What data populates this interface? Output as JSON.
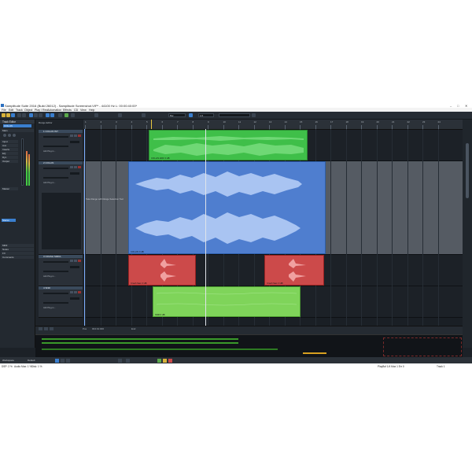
{
  "window": {
    "title": "Samplitude Suite 2016 (Build 26012) - Samplitude Screenshot.VIP* - 44100 Hz L: 00:00:40:00*",
    "min": "–",
    "max": "□",
    "close": "✕"
  },
  "menu": [
    "File",
    "Edit",
    "Track",
    "Object",
    "Play / Rec",
    "Automation",
    "Effects",
    "CD",
    "View",
    "Help"
  ],
  "toolbar": {
    "icons": [
      "new-icon",
      "open-icon",
      "save-icon",
      "undo-icon",
      "redo-icon",
      "cursor-icon",
      "range-icon",
      "cut-icon",
      "draw-icon",
      "zoom-icon",
      "mix-icon",
      "record-icon"
    ],
    "bpm_select": "Bar",
    "grid_select": "1/4",
    "search_placeholder": ""
  },
  "left_panel": {
    "header": "Track Editor",
    "section_main": "Main",
    "track_name": "COLLIN",
    "labels": [
      "Input",
      "Aux",
      "Inserts",
      "EQ",
      "Dyn",
      "Output"
    ],
    "routing": "Master",
    "preset_label": "Stereo",
    "sections": [
      "MIDI",
      "Notes",
      "FX",
      "Comments"
    ]
  },
  "tracks": [
    {
      "num": "1",
      "name": "COLLIN INT",
      "add_plugin": "Add Plug-in..."
    },
    {
      "num": "2",
      "name": "COLLIN",
      "add_plugin": "Add Plug-in..."
    },
    {
      "num": "3",
      "name": "CRASH SIMUL",
      "add_plugin": "Add Plug-in..."
    },
    {
      "num": "4",
      "name": "SNR",
      "add_plugin": "Add Plug-in..."
    }
  ],
  "track_header_title": "Range Editor",
  "ruler": [
    "1",
    "2",
    "3",
    "4",
    "5",
    "6",
    "7",
    "8",
    "9",
    "10",
    "11",
    "12",
    "13",
    "14",
    "15",
    "16",
    "17",
    "18",
    "19",
    "20",
    "21",
    "22",
    "23",
    "24"
  ],
  "objects": {
    "obj1": "COLLIN.WAV  0 dB",
    "obj2": "COLLIN  0 dB",
    "obj3a": "Crash Sam  0 dB",
    "obj3b": "Crash Sam  0 dB",
    "obj4": "SNR  0 dB",
    "note_text": "Take Range with Range Selection Tool"
  },
  "transport": {
    "position": "004:01:000",
    "marker": "Pos",
    "end": "End"
  },
  "bottom": {
    "workspace_label": "Workspace",
    "workspace_value": "Default"
  },
  "status": {
    "dsp": "DSP: 2 %",
    "audio": "Audio Max: 1 %",
    "disk": "Disk: 1 %",
    "center": "PlayBuf 1/4  Max 1  Err 0",
    "track": "Track 1"
  },
  "colors": {
    "green": "#3fbf49",
    "blue": "#4f7ecf",
    "red": "#cc4a4a",
    "lime": "#7fd45a",
    "accent": "#3a7fcf"
  }
}
